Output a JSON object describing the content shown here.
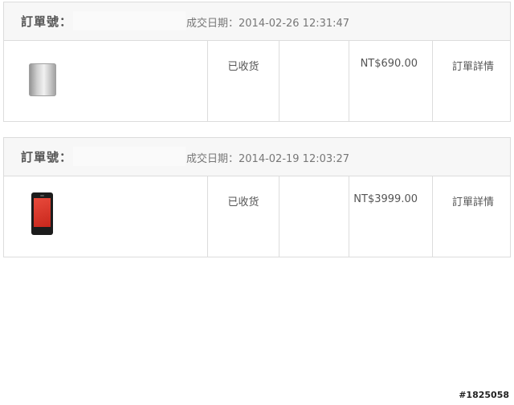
{
  "orders": [
    {
      "order_label": "訂單號：",
      "date_text": "成交日期：2014-02-26 12:31:47",
      "product_icon": "power-bank-icon",
      "status": "已收货",
      "price": "NT$690.00",
      "detail_link": "訂單詳情"
    },
    {
      "order_label": "訂單號：",
      "date_text": "成交日期：2014-02-19 12:03:27",
      "product_icon": "smartphone-icon",
      "status": "已收货",
      "price": "NT$3999.00",
      "detail_link": "訂單詳情"
    }
  ],
  "watermark": "#1825058"
}
